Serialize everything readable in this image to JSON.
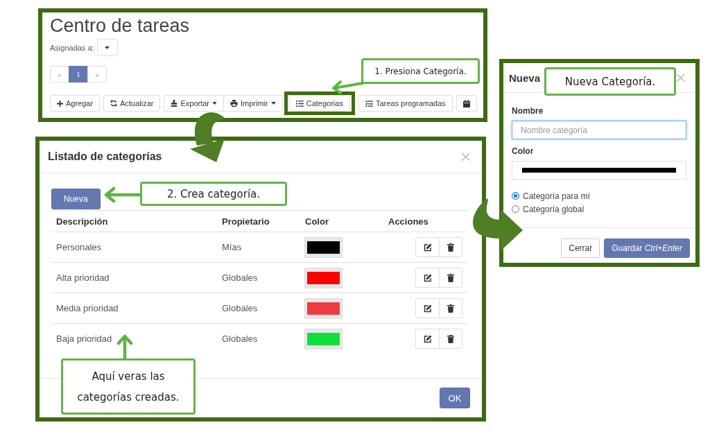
{
  "task_center": {
    "title": "Centro de tareas",
    "assigned_filter": {
      "label": "Asignadas a:"
    },
    "pagination": [
      {
        "label": "«",
        "selected": false
      },
      {
        "label": "1",
        "selected": true
      },
      {
        "label": "»",
        "selected": false
      }
    ],
    "toolbar": [
      {
        "label": "Agregar",
        "dropdown": false,
        "highlighted": false
      },
      {
        "label": "Actualizar",
        "dropdown": false,
        "highlighted": false
      },
      {
        "label": "Exportar",
        "dropdown": true,
        "highlighted": false
      },
      {
        "label": "Imprimir",
        "dropdown": true,
        "highlighted": false
      },
      {
        "label": "Categorias",
        "dropdown": false,
        "highlighted": true
      },
      {
        "label": "Tareas programadas",
        "dropdown": false,
        "highlighted": false
      },
      {
        "dropdown": false,
        "highlighted": false
      }
    ]
  },
  "category_list": {
    "title": "Listado de categorías",
    "close": "×",
    "new_button": "Nueva",
    "columns": [
      "Descripción",
      "Propietario",
      "Color",
      "Acciones"
    ],
    "rows": [
      {
        "description": "Personales",
        "owner": "Mías",
        "color": "#000000"
      },
      {
        "description": "Alta prioridad",
        "owner": "Globales",
        "color": "#ff0000"
      },
      {
        "description": "Media prioridad",
        "owner": "Globales",
        "color": "#ee3b3f"
      },
      {
        "description": "Baja prioridad",
        "owner": "Globales",
        "color": "#0fe03a"
      }
    ],
    "ok_button": "OK"
  },
  "new_category": {
    "title": "Nueva",
    "close": "×",
    "name_field": {
      "label": "Nombre",
      "placeholder": "Nombre categoría",
      "focused": true
    },
    "color_field": {
      "label": "Color",
      "color": "#000000"
    },
    "scope_options": [
      {
        "label": "Categoría para mí",
        "selected": true
      },
      {
        "label": "Categoría global",
        "selected": false
      }
    ],
    "buttons": [
      {
        "label": "Cerrar",
        "kind": "default"
      },
      {
        "label": "Guardar *Ctrl+Enter*",
        "kind": "primary"
      }
    ]
  },
  "annotations": [
    {
      "text": "1. Presiona Categoría."
    },
    {
      "text": "2. Crea categoría."
    },
    {
      "text": "Aquí veras las categorías creadas."
    },
    {
      "text": "Nueva Categoría."
    }
  ]
}
